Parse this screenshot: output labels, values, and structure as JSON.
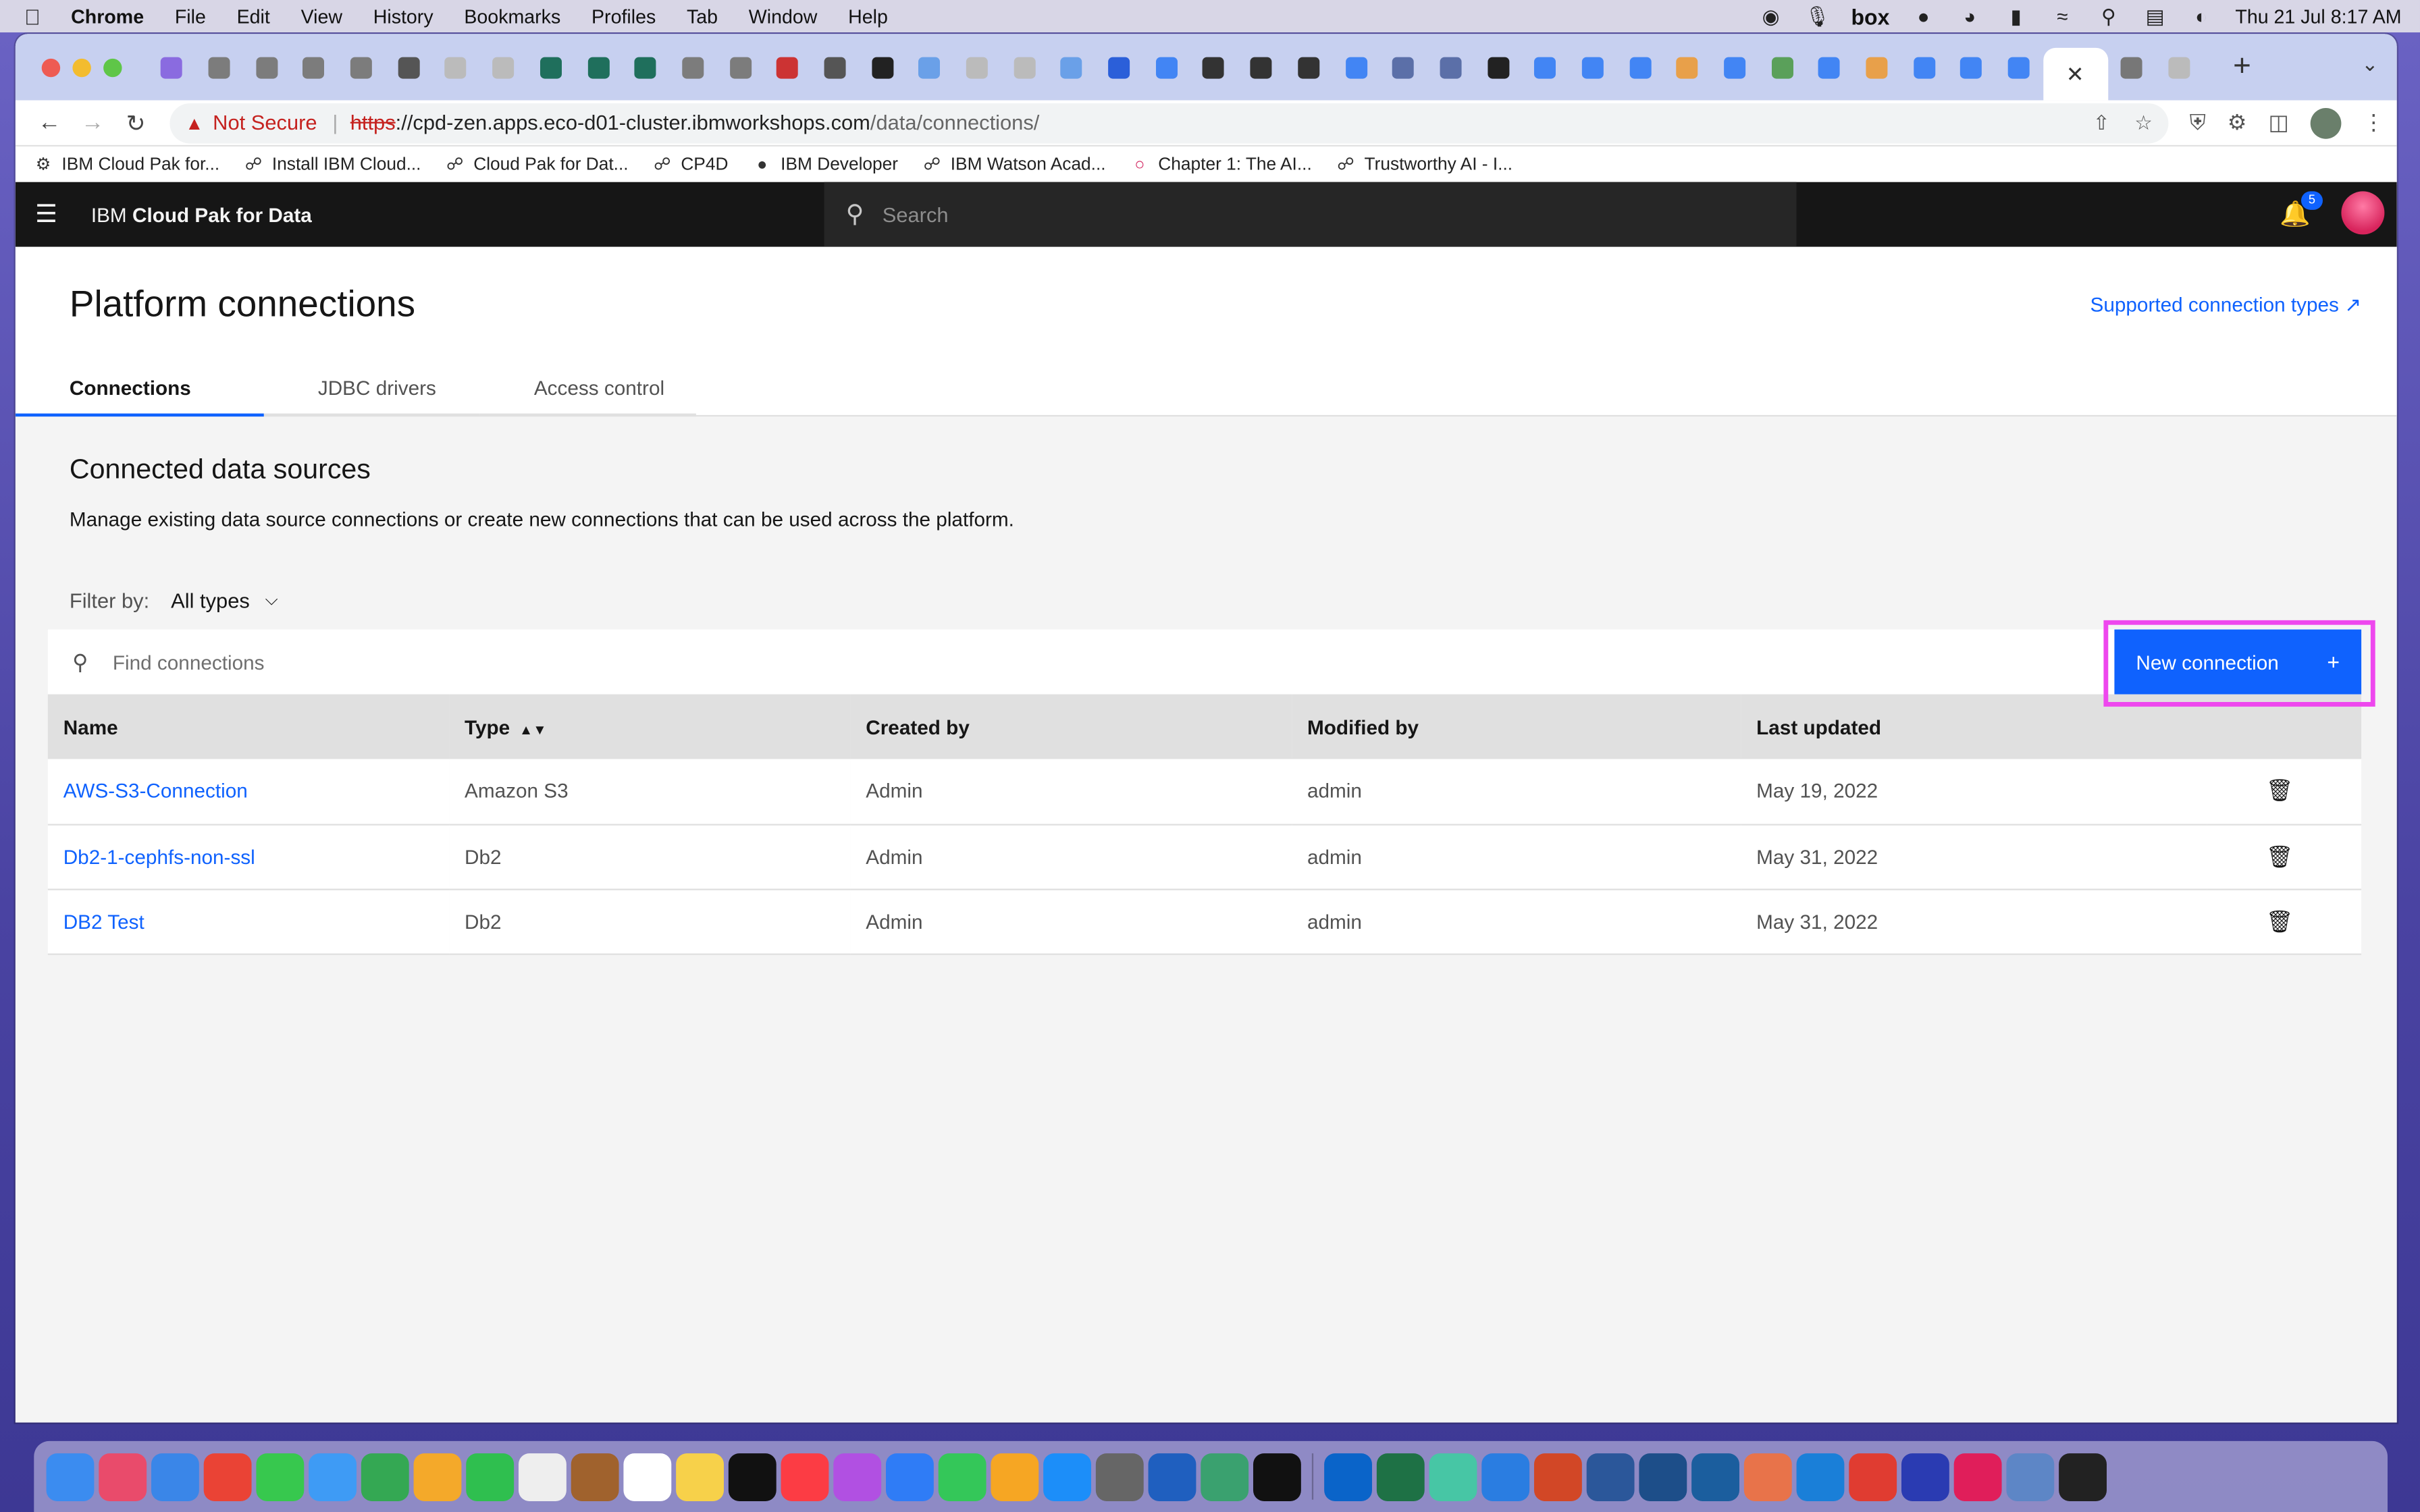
{
  "menubar": {
    "app": "Chrome",
    "items": [
      "File",
      "Edit",
      "View",
      "History",
      "Bookmarks",
      "Profiles",
      "Tab",
      "Window",
      "Help"
    ],
    "clock": "Thu 21 Jul  8:17 AM",
    "box_label": "box"
  },
  "browser": {
    "security_label": "Not Secure",
    "url_scheme": "https",
    "url_sep": "://",
    "url_host": "cpd-zen.apps.eco-d01-cluster.ibmworkshops.com",
    "url_path": "/data/connections/",
    "bookmarks": [
      "IBM Cloud Pak for...",
      "Install IBM Cloud...",
      "Cloud Pak for Dat...",
      "CP4D",
      "IBM Developer",
      "IBM Watson Acad...",
      "Chapter 1: The AI...",
      "Trustworthy AI - I..."
    ]
  },
  "shell": {
    "brand_prefix": "IBM",
    "brand_name": "Cloud Pak for Data",
    "search_placeholder": "Search",
    "notification_count": "5"
  },
  "page": {
    "title": "Platform connections",
    "supported_link": "Supported connection types",
    "tabs": [
      "Connections",
      "JDBC drivers",
      "Access control"
    ],
    "section_title": "Connected data sources",
    "section_desc": "Manage existing data source connections or create new connections that can be used across the platform.",
    "filter_label": "Filter by:",
    "filter_value": "All types",
    "find_placeholder": "Find connections",
    "new_connection_label": "New connection",
    "columns": [
      "Name",
      "Type",
      "Created by",
      "Modified by",
      "Last updated"
    ],
    "rows": [
      {
        "name": "AWS-S3-Connection",
        "type": "Amazon S3",
        "created_by": "Admin",
        "modified_by": "admin",
        "last_updated": "May 19, 2022"
      },
      {
        "name": "Db2-1-cephfs-non-ssl",
        "type": "Db2",
        "created_by": "Admin",
        "modified_by": "admin",
        "last_updated": "May 31, 2022"
      },
      {
        "name": "DB2 Test",
        "type": "Db2",
        "created_by": "Admin",
        "modified_by": "admin",
        "last_updated": "May 31, 2022"
      }
    ]
  },
  "colors": {
    "accent": "#0f62fe",
    "shell_bg": "#161616",
    "highlight_box": "#ee47ee"
  }
}
